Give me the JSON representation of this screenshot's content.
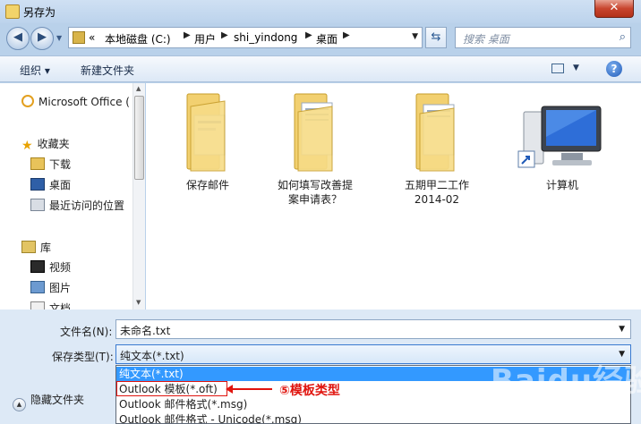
{
  "window": {
    "title": "另存为",
    "close_label": "✕"
  },
  "nav": {
    "back_icon": "◀",
    "forward_icon": "▶",
    "address": [
      "«",
      "本地磁盘 (C:)",
      "用户",
      "shi_yindong",
      "桌面"
    ],
    "search_placeholder": "搜索 桌面"
  },
  "toolbar": {
    "organize": "组织 ▾",
    "new_folder": "新建文件夹",
    "help": "?"
  },
  "sidebar": {
    "items": [
      {
        "label": "Microsoft Office (",
        "icon": "outlook-icon"
      },
      {
        "label": "收藏夹",
        "icon": "star-icon"
      },
      {
        "label": "下载",
        "icon": "download-icon"
      },
      {
        "label": "桌面",
        "icon": "desktop-icon"
      },
      {
        "label": "最近访问的位置",
        "icon": "recent-places-icon"
      },
      {
        "label": "库",
        "icon": "library-icon"
      },
      {
        "label": "视频",
        "icon": "video-icon"
      },
      {
        "label": "图片",
        "icon": "pictures-icon"
      },
      {
        "label": "文档",
        "icon": "documents-icon"
      }
    ]
  },
  "files": [
    {
      "label_1": "保存邮件",
      "label_2": "",
      "type": "folder"
    },
    {
      "label_1": "如何填写改善提",
      "label_2": "案申请表？",
      "type": "folder"
    },
    {
      "label_1": "五期甲二工作",
      "label_2": "2014-02",
      "type": "folder"
    },
    {
      "label_1": "计算机",
      "label_2": "",
      "type": "computer-shortcut"
    }
  ],
  "form": {
    "filename_label": "文件名(N):",
    "filename_value": "未命名.txt",
    "savetype_label": "保存类型(T):",
    "savetype_value": "纯文本(*.txt)"
  },
  "dropdown_options": [
    "纯文本(*.txt)",
    "Outlook 模板(*.oft)",
    "Outlook 邮件格式(*.msg)",
    "Outlook 邮件格式 - Unicode(*.msg)"
  ],
  "selected_option_index": 0,
  "hide_folders": "隐藏文件夹",
  "annotation": {
    "text": "⑤模板类型",
    "color": "#e0140e"
  },
  "watermark": "Baidu经验",
  "colors": {
    "accent": "#3399ff",
    "annotation": "#e0140e"
  }
}
